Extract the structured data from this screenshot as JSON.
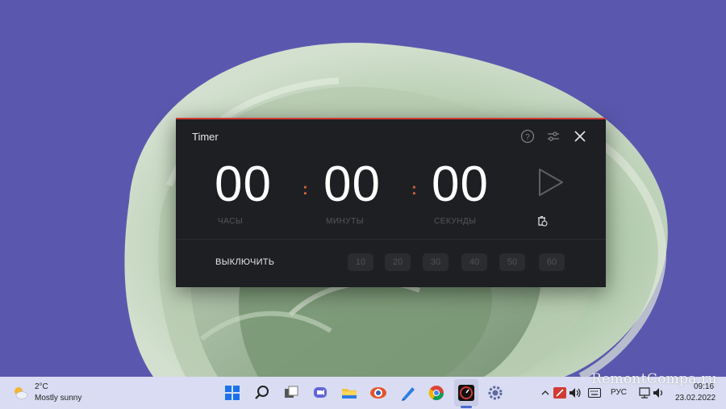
{
  "timer": {
    "title": "Timer",
    "hours": "00",
    "minutes": "00",
    "seconds": "00",
    "separator": ":",
    "unit_hours": "ЧАСЫ",
    "unit_minutes": "МИНУТЫ",
    "unit_seconds": "СЕКУНДЫ",
    "off_label": "ВЫКЛЮЧИТЬ",
    "presets": [
      "10",
      "20",
      "30",
      "40",
      "50",
      "60"
    ],
    "icons": {
      "help": "help-circle-icon",
      "settings": "sliders-icon",
      "close": "close-icon",
      "play": "play-icon",
      "reset": "timer-reset-icon"
    },
    "colors": {
      "accent": "#d23a35",
      "separator": "#d7643d",
      "background": "#1e1f22"
    }
  },
  "taskbar": {
    "weather": {
      "temp": "2°C",
      "desc": "Mostly sunny"
    },
    "apps": [
      "start-icon",
      "search-icon",
      "task-view-icon",
      "chat-icon",
      "file-explorer-icon",
      "app-icon",
      "pen-icon",
      "chrome-icon",
      "timer-app-icon",
      "settings-icon"
    ],
    "tray": {
      "lang": "РУС",
      "time": "09:16",
      "date": "23.02.2022"
    }
  },
  "watermark": "RemontCompa.ru"
}
